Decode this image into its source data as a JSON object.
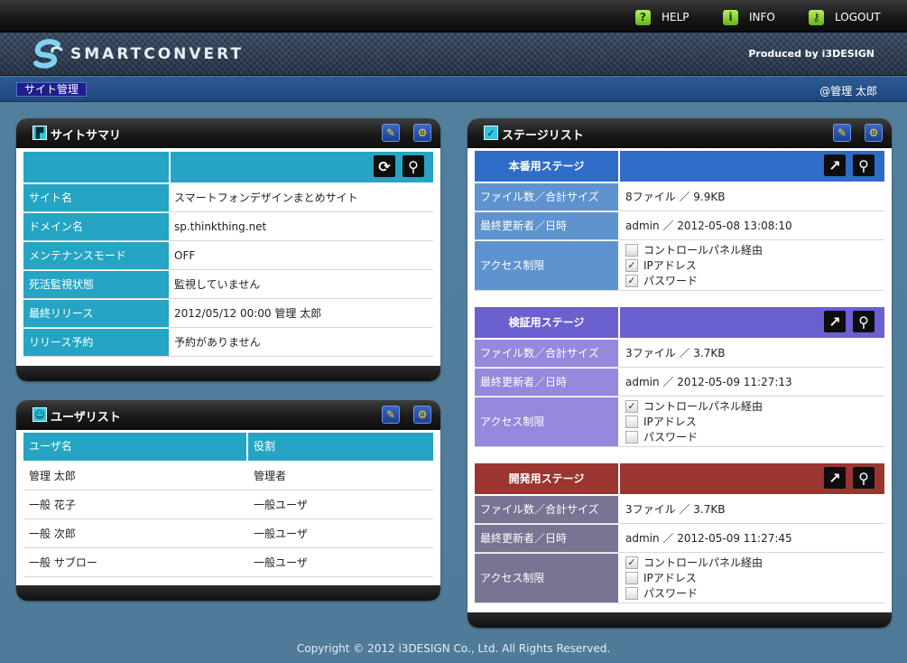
{
  "topnav": {
    "help": "HELP",
    "info": "INFO",
    "logout": "LOGOUT"
  },
  "brand": {
    "logo_text": "SMARTCONVERT",
    "produced_by": "Produced by i3DESIGN"
  },
  "breadcrumb": {
    "current": "サイト管理",
    "user": "@管理 太郎"
  },
  "site_summary": {
    "title": "サイトサマリ",
    "rows": [
      {
        "label": "サイト名",
        "value": "スマートフォンデザインまとめサイト"
      },
      {
        "label": "ドメイン名",
        "value": "sp.thinkthing.net"
      },
      {
        "label": "メンテナンスモード",
        "value": "OFF"
      },
      {
        "label": "死活監視状態",
        "value": "監視していません"
      },
      {
        "label": "最終リリース",
        "value": "2012/05/12 00:00 管理 太郎"
      },
      {
        "label": "リリース予約",
        "value": "予約がありません"
      }
    ]
  },
  "user_list": {
    "title": "ユーザリスト",
    "columns": [
      "ユーザ名",
      "役割"
    ],
    "rows": [
      [
        "管理 太郎",
        "管理者"
      ],
      [
        "一般 花子",
        "一般ユーザ"
      ],
      [
        "一般 次郎",
        "一般ユーザ"
      ],
      [
        "一般 サブロー",
        "一般ユーザ"
      ]
    ]
  },
  "stage_list": {
    "title": "ステージリスト",
    "labels": {
      "files": "ファイル数／合計サイズ",
      "updated": "最終更新者／日時",
      "access": "アクセス制限"
    },
    "access_options": [
      "コントロールパネル経由",
      "IPアドレス",
      "パスワード"
    ],
    "stages": [
      {
        "name": "本番用ステージ",
        "files": "8ファイル ／ 9.9KB",
        "updated": "admin ／ 2012-05-08 13:08:10",
        "checked": [
          false,
          true,
          true
        ],
        "color_head": "#2f6cc7",
        "color_label": "#5e93cf"
      },
      {
        "name": "検証用ステージ",
        "files": "3ファイル ／ 3.7KB",
        "updated": "admin ／ 2012-05-09 11:27:13",
        "checked": [
          true,
          false,
          false
        ],
        "color_head": "#6a60cf",
        "color_label": "#9489dc"
      },
      {
        "name": "開発用ステージ",
        "files": "3ファイル ／ 3.7KB",
        "updated": "admin ／ 2012-05-09 11:27:45",
        "checked": [
          true,
          false,
          false
        ],
        "color_head": "#9a3530",
        "color_label": "#7a7393"
      }
    ]
  },
  "footer": {
    "copyright": "Copyright © 2012 i3DESIGN Co., Ltd. All Rights Reserved."
  }
}
